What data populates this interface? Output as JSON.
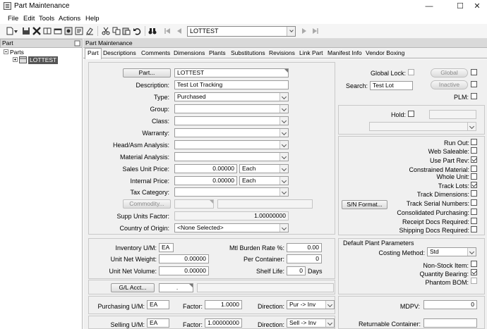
{
  "window": {
    "title": "Part Maintenance",
    "minimize": "—",
    "maximize": "☐",
    "close": "✕"
  },
  "menu": [
    "File",
    "Edit",
    "Tools",
    "Actions",
    "Help"
  ],
  "toolbar": {
    "record": "LOTTEST"
  },
  "tree": {
    "header": "Part",
    "root": "Parts",
    "child": "LOTTEST"
  },
  "main": {
    "header": "Part Maintenance",
    "tabs": [
      "Part",
      "Descriptions",
      "Comments",
      "Dimensions",
      "Plants",
      "Substitutions",
      "Revisions",
      "Link Part",
      "Manifest Info",
      "Vendor Boxing"
    ]
  },
  "form": {
    "part_btn": "Part...",
    "part": "LOTTEST",
    "description_label": "Description:",
    "description": "Test Lot Tracking",
    "type_label": "Type:",
    "type": "Purchased",
    "group_label": "Group:",
    "class_label": "Class:",
    "warranty_label": "Warranty:",
    "head_asm_label": "Head/Asm Analysis:",
    "material_label": "Material Analysis:",
    "sales_price_label": "Sales Unit Price:",
    "sales_price": "0.00000",
    "sales_uom": "Each",
    "internal_price_label": "Internal Price:",
    "internal_price": "0.00000",
    "internal_uom": "Each",
    "tax_label": "Tax Category:",
    "commodity_btn": "Commodity...",
    "supp_factor_label": "Supp Units Factor:",
    "supp_factor": "1.00000000",
    "origin_label": "Country of Origin:",
    "origin": "<None Selected>",
    "global_lock_label": "Global Lock:",
    "global_btn": "Global",
    "search_label": "Search:",
    "search": "Test Lot",
    "inactive_btn": "Inactive",
    "plm_label": "PLM:",
    "hold_label": "Hold:",
    "sn_format_btn": "S/N Format...",
    "checks": [
      {
        "label": "Run Out:",
        "on": false
      },
      {
        "label": "Web Saleable:",
        "on": false
      },
      {
        "label": "Use Part Rev:",
        "on": true
      },
      {
        "label": "Constrained Material:",
        "on": false
      },
      {
        "label": "Whole Unit:",
        "on": false
      },
      {
        "label": "Track Lots:",
        "on": true
      },
      {
        "label": "Track Dimensions:",
        "on": false
      },
      {
        "label": "Track Serial Numbers:",
        "on": false
      },
      {
        "label": "Consolidated Purchasing:",
        "on": false
      },
      {
        "label": "Receipt Docs Required:",
        "on": false
      },
      {
        "label": "Shipping Docs Required:",
        "on": false
      }
    ],
    "inv_uom_label": "Inventory U/M:",
    "inv_uom": "EA",
    "mtl_burden_label": "Mtl Burden Rate %:",
    "mtl_burden": "0.00",
    "net_weight_label": "Unit Net Weight:",
    "net_weight": "0.00000",
    "per_container_label": "Per Container:",
    "per_container": "0",
    "net_volume_label": "Unit Net Volume:",
    "net_volume": "0.00000",
    "shelf_life_label": "Shelf Life:",
    "shelf_life": "0",
    "days_label": "Days",
    "gl_btn": "G/L Acct...",
    "gl_value": ".",
    "plant_params_label": "Default Plant Parameters",
    "costing_label": "Costing Method:",
    "costing": "Std",
    "non_stock_label": "Non-Stock Item:",
    "qty_bearing_label": "Quantity Bearing:",
    "phantom_label": "Phantom BOM:",
    "purchasing_uom_label": "Purchasing U/M:",
    "purchasing_uom": "EA",
    "factor_label": "Factor:",
    "purchasing_factor": "1.0000",
    "direction_label": "Direction:",
    "purchasing_dir": "Pur -> Inv",
    "mdpv_label": "MDPV:",
    "mdpv": "0",
    "selling_uom_label": "Selling U/M:",
    "selling_uom": "EA",
    "selling_factor": "1.00000000",
    "selling_dir": "Sell -> Inv",
    "returnable_label": "Returnable Container:"
  }
}
